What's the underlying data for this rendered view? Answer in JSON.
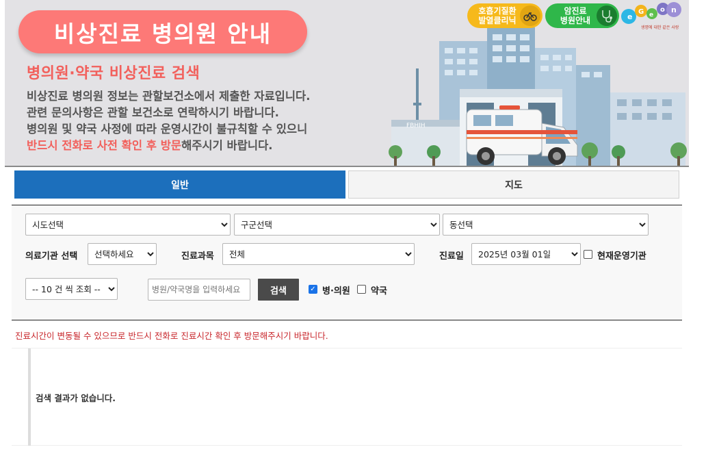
{
  "banner": {
    "title": "비상진료 병의원 안내",
    "subtitle": "병의원·약국 비상진료 검색",
    "line1": "비상진료 병의원 정보는 관할보건소에서 제출한 자료입니다.",
    "line2": "관련 문의사항은 관할 보건소로 연락하시기 바랍니다.",
    "line3": "병의원 및 약국 사정에 따라 운영시간이 불규칙할 수 있으니",
    "line4_highlight": "반드시 전화로 사전 확인 후 방문",
    "line4_rest": "해주시기 바랍니다.",
    "badge_resp_line1": "호흡기질환",
    "badge_resp_line2": "발열클리닉",
    "badge_cancer_line1": "암진료",
    "badge_cancer_line2": "병원안내",
    "logo_tagline": "생명에 대한 같은 사랑",
    "sign_text": "FBHIH"
  },
  "tabs": [
    {
      "label": "일반",
      "active": true
    },
    {
      "label": "지도",
      "active": false
    }
  ],
  "filters": {
    "sido": "시도선택",
    "gugun": "구군선택",
    "dong": "동선택",
    "inst_label": "의료기관 선택",
    "inst_value": "선택하세요",
    "dept_label": "진료과목",
    "dept_value": "전체",
    "date_label": "진료일",
    "date_value": "2025년 03월 01일",
    "open_now_label": "현재운영기관",
    "open_now_checked": false,
    "page_size": "-- 10 건 씩 조회 --",
    "search_placeholder": "병원/약국명을 입력하세요",
    "search_button": "검색",
    "hospital_label": "병·의원",
    "hospital_checked": true,
    "pharmacy_label": "약국",
    "pharmacy_checked": false
  },
  "notice": "진료시간이 변동될 수 있으므로 반드시 전화로 진료시간 확인 후 방문해주시기 바랍니다.",
  "result": {
    "empty_message": "검색 결과가 없습니다."
  },
  "colors": {
    "banner_bg": "#e3e2e5",
    "title_pill": "#fd7977",
    "accent_red": "#f2605c",
    "tab_active": "#1c6fbc",
    "badge_yellow": "#f6b91b",
    "badge_green": "#2fb74a",
    "notice_red": "#c8262b",
    "search_btn": "#4a4a4a"
  }
}
